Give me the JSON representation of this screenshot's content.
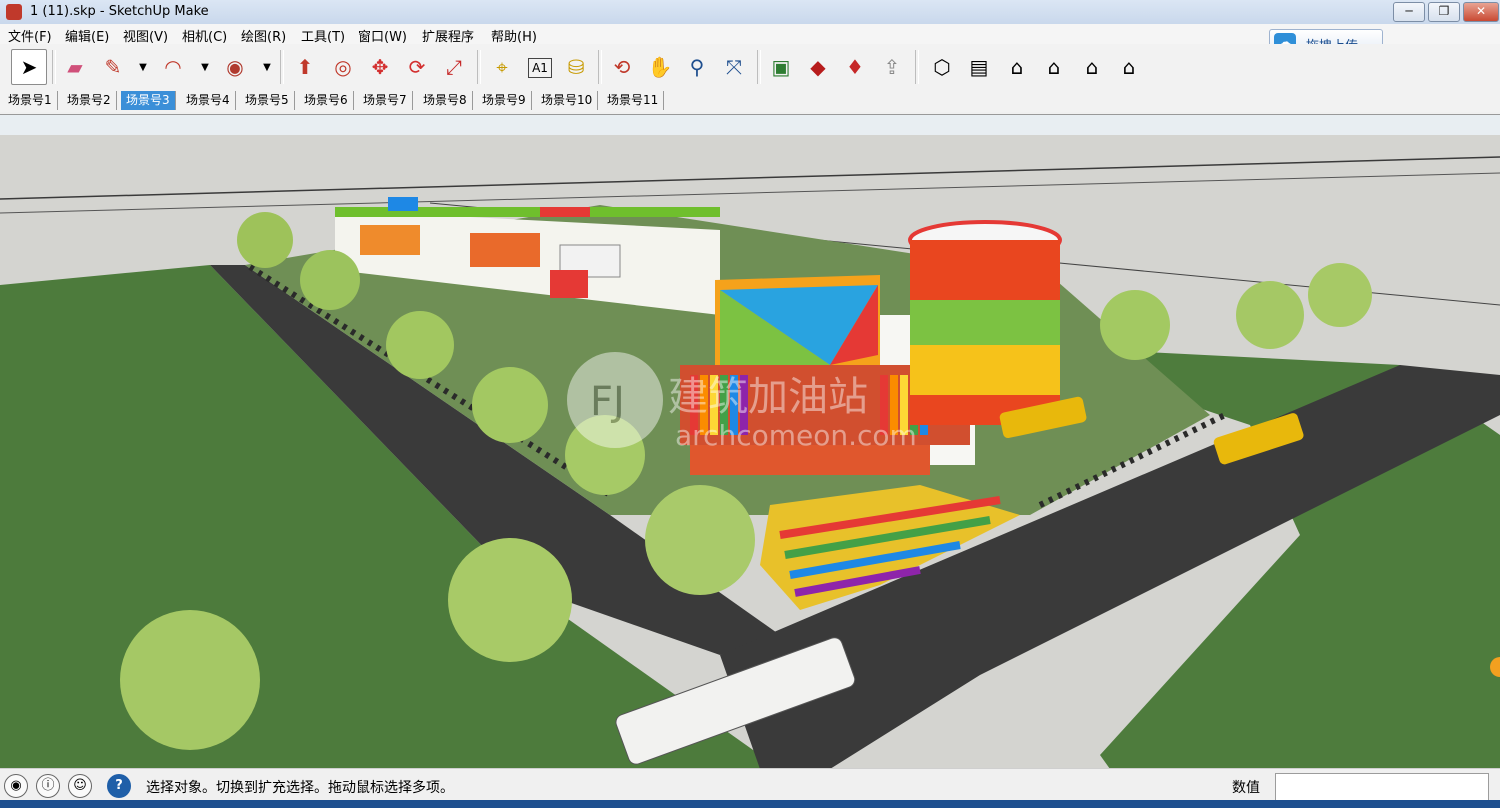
{
  "window": {
    "title": "1 (11).skp - SketchUp Make",
    "buttons": {
      "minimize": "─",
      "restore": "❐",
      "close": "✕"
    }
  },
  "menu": [
    "文件(F)",
    "编辑(E)",
    "视图(V)",
    "相机(C)",
    "绘图(R)",
    "工具(T)",
    "窗口(W)",
    "扩展程序",
    "帮助(H)"
  ],
  "upload": {
    "label": "拖拽上传",
    "icon": "cloud-upload-icon"
  },
  "toolbar": {
    "tools": [
      {
        "name": "select-tool",
        "glyph": "➤"
      },
      {
        "name": "eraser-tool",
        "glyph": "▰"
      },
      {
        "name": "line-tool",
        "glyph": "✎"
      },
      {
        "name": "arc-tool",
        "glyph": "◠"
      },
      {
        "name": "shape-tool",
        "glyph": "◉"
      },
      {
        "name": "push-pull-tool",
        "glyph": "⬆"
      },
      {
        "name": "offset-tool",
        "glyph": "◎"
      },
      {
        "name": "move-tool",
        "glyph": "✥"
      },
      {
        "name": "rotate-tool",
        "glyph": "⟳"
      },
      {
        "name": "scale-tool",
        "glyph": "⤢"
      },
      {
        "name": "tape-measure-tool",
        "glyph": "⌖"
      },
      {
        "name": "text-tool",
        "glyph": "A1"
      },
      {
        "name": "paint-bucket-tool",
        "glyph": "⛁"
      },
      {
        "name": "orbit-tool",
        "glyph": "⟲"
      },
      {
        "name": "pan-tool",
        "glyph": "✋"
      },
      {
        "name": "zoom-tool",
        "glyph": "⚲"
      },
      {
        "name": "zoom-extents-tool",
        "glyph": "⤧"
      },
      {
        "name": "warehouse-tool",
        "glyph": "▣"
      },
      {
        "name": "extension-tool",
        "glyph": "◆"
      },
      {
        "name": "ruby-tool",
        "glyph": "♦"
      },
      {
        "name": "share-tool",
        "glyph": "⇪"
      },
      {
        "name": "iso-view",
        "glyph": "⬡"
      },
      {
        "name": "top-view",
        "glyph": "▤"
      },
      {
        "name": "front-view",
        "glyph": "⌂"
      },
      {
        "name": "right-view",
        "glyph": "⌂"
      },
      {
        "name": "back-view",
        "glyph": "⌂"
      },
      {
        "name": "left-view",
        "glyph": "⌂"
      }
    ]
  },
  "scenes": {
    "tabs": [
      "场景号1",
      "场景号2",
      "场景号3",
      "场景号4",
      "场景号5",
      "场景号6",
      "场景号7",
      "场景号8",
      "场景号9",
      "场景号10",
      "场景号11"
    ],
    "active_index": 2
  },
  "viewport": {
    "watermark": {
      "monogram": "FJ",
      "cn": "建筑加油站",
      "url": "archcomeon.com"
    },
    "colors": {
      "sky": "#e6e6e6",
      "ground": "#d3d3cf",
      "grass": "#4a7a3a",
      "road": "#3b3b3b"
    }
  },
  "status": {
    "message": "选择对象。切换到扩充选择。拖动鼠标选择多项。",
    "measure_label": "数值",
    "measure_value": ""
  },
  "accent_color": "#3b8fd8"
}
